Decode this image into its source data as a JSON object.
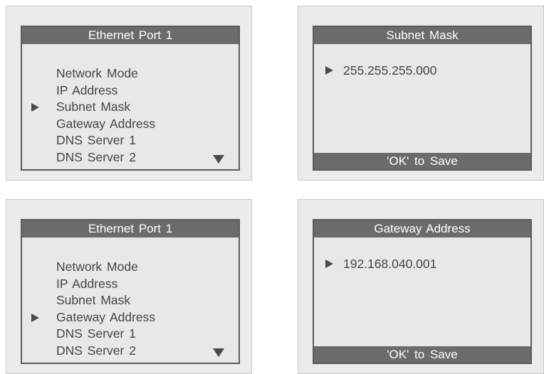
{
  "screens": [
    {
      "title": "Ethernet Port 1",
      "items": [
        "Network Mode",
        "IP Address",
        "Subnet Mask",
        "Gateway Address",
        "DNS Server 1",
        "DNS Server 2"
      ],
      "selected": "Subnet Mask",
      "cursor_icon": "triangle-right",
      "scroll_icon": "triangle-down"
    },
    {
      "title": "Subnet Mask",
      "value": "255.255.255.000",
      "footer": "'OK' to Save"
    },
    {
      "title": "Ethernet Port 1",
      "items": [
        "Network Mode",
        "IP Address",
        "Subnet Mask",
        "Gateway Address",
        "DNS Server 1",
        "DNS Server 2"
      ],
      "selected": "Gateway Address",
      "cursor_icon": "triangle-right",
      "scroll_icon": "triangle-down"
    },
    {
      "title": "Gateway Address",
      "value": "192.168.040.001",
      "footer": "'OK' to Save"
    }
  ],
  "colors": {
    "title_bar": "#6b6b6b",
    "screen_bg": "#e8e8e8",
    "text": "#454545"
  }
}
